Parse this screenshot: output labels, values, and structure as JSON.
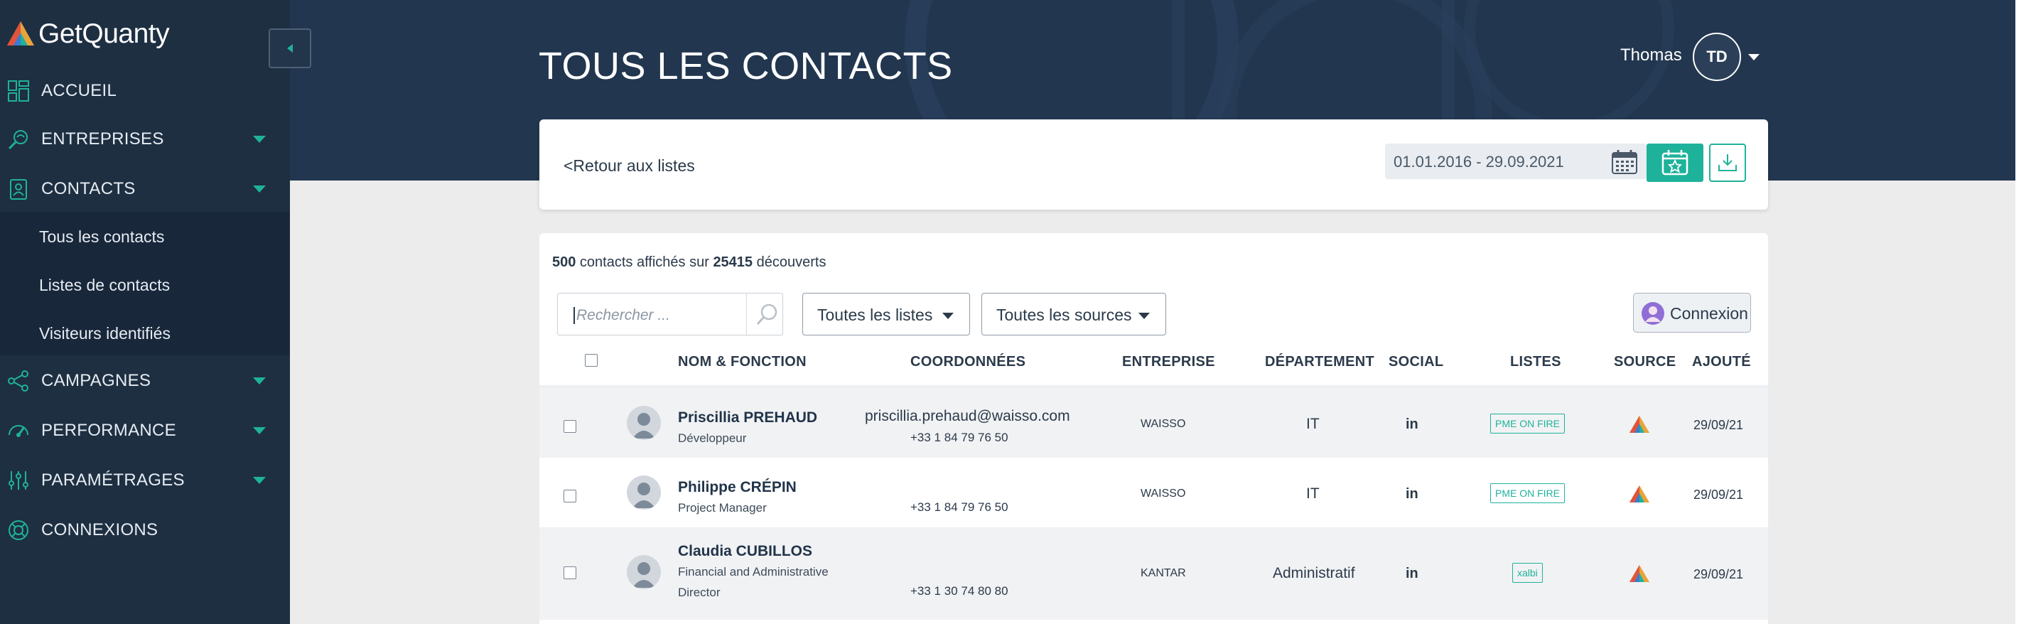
{
  "app": {
    "logo_text": "GetQuanty"
  },
  "sidebar": {
    "items": [
      {
        "label": "ACCUEIL",
        "icon": "dashboard-icon",
        "has_caret": false
      },
      {
        "label": "ENTREPRISES",
        "icon": "search-building-icon",
        "has_caret": true
      },
      {
        "label": "CONTACTS",
        "icon": "contact-card-icon",
        "has_caret": true
      },
      {
        "label": "CAMPAGNES",
        "icon": "share-nodes-icon",
        "has_caret": true
      },
      {
        "label": "PERFORMANCE",
        "icon": "gauge-icon",
        "has_caret": true
      },
      {
        "label": "PARAMÉTRAGES",
        "icon": "sliders-icon",
        "has_caret": true
      },
      {
        "label": "CONNEXIONS",
        "icon": "lifebuoy-icon",
        "has_caret": false
      }
    ],
    "contacts_subitems": [
      {
        "label": "Tous les contacts"
      },
      {
        "label": "Listes de contacts"
      },
      {
        "label": "Visiteurs identifiés"
      }
    ]
  },
  "header": {
    "title": "TOUS LES CONTACTS",
    "user_name": "Thomas",
    "user_initials": "TD"
  },
  "toolbar": {
    "back_label": "<Retour aux listes",
    "date_range": "01.01.2016 - 29.09.2021"
  },
  "summary": {
    "shown": "500",
    "middle": " contacts affichés sur ",
    "total": "25415",
    "suffix": " découverts"
  },
  "filters": {
    "search_placeholder": "Rechercher ...",
    "lists_dropdown": "Toutes les listes",
    "sources_dropdown": "Toutes les sources",
    "connexion_button": "Connexion"
  },
  "table": {
    "columns": [
      "NOM & FONCTION",
      "COORDONNÉES",
      "ENTREPRISE",
      "DÉPARTEMENT",
      "SOCIAL",
      "LISTES",
      "SOURCE",
      "AJOUTÉ"
    ],
    "rows": [
      {
        "name": "Priscillia PREHAUD",
        "role": "Développeur",
        "email": "priscillia.prehaud@waisso.com",
        "phone": "+33 1 84 79 76 50",
        "company": "WAISSO",
        "department": "IT",
        "social": "in",
        "list": "PME ON FIRE",
        "date": "29/09/21"
      },
      {
        "name": "Philippe CRÉPIN",
        "role": "Project Manager",
        "email": "",
        "phone": "+33 1 84 79 76 50",
        "company": "WAISSO",
        "department": "IT",
        "social": "in",
        "list": "PME ON FIRE",
        "date": "29/09/21"
      },
      {
        "name": "Claudia CUBILLOS",
        "role_line1": "Financial and Administrative",
        "role_line2": "Director",
        "email": "",
        "phone": "+33 1 30 74 80 80",
        "company": "KANTAR",
        "department": "Administratif",
        "social": "in",
        "list": "xalbi",
        "date": "29/09/21"
      }
    ]
  },
  "colors": {
    "sidebar_bg": "#1e2f42",
    "accent": "#1fb29a",
    "header_bg": "#22364f"
  }
}
